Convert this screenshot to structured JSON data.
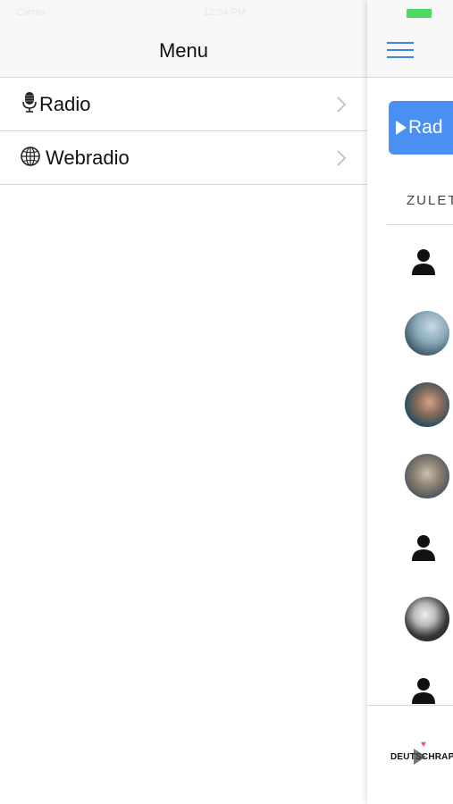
{
  "status_bar": {
    "left_text": "Carrier",
    "time": "12:34 PM",
    "battery_color": "#4cd964"
  },
  "menu": {
    "title": "Menu",
    "items": [
      {
        "label": "Radio",
        "icon": "microphone-icon"
      },
      {
        "label": "Webradio",
        "icon": "globe-icon"
      }
    ]
  },
  "main": {
    "nav_icon": "hamburger-menu-icon",
    "radio_button_label": "Rad",
    "radio_button_color": "#4a8ff2",
    "section_header": "ZULET",
    "avatars": [
      {
        "type": "placeholder",
        "icon": "person-icon"
      },
      {
        "type": "photo"
      },
      {
        "type": "photo"
      },
      {
        "type": "photo"
      },
      {
        "type": "placeholder",
        "icon": "person-icon"
      },
      {
        "type": "photo"
      },
      {
        "type": "placeholder",
        "icon": "person-icon"
      }
    ]
  },
  "player": {
    "station_logo_text": "DEUTSCHRAP",
    "play_icon": "play-icon"
  },
  "colors": {
    "accent": "#3d86e0",
    "nav_background": "#f7f7f7",
    "separator": "#d6d6d6"
  }
}
